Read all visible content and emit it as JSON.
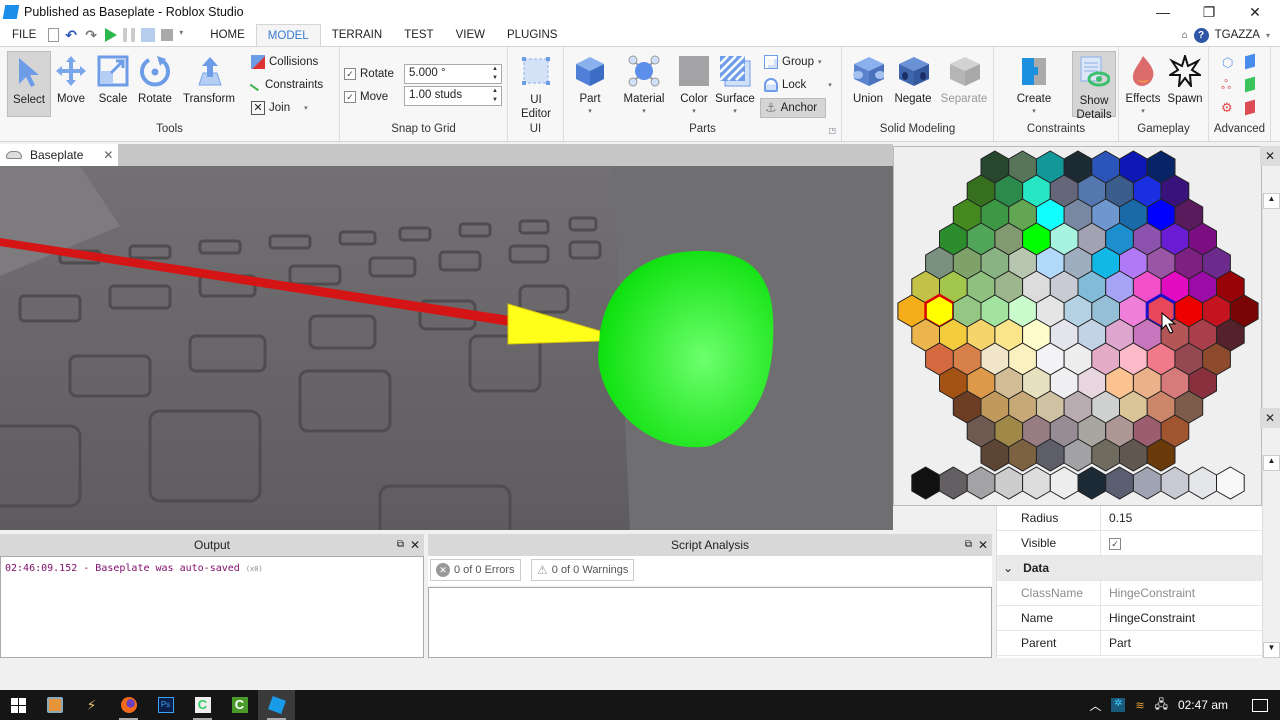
{
  "window": {
    "title": "Published as Baseplate - Roblox Studio",
    "controls": {
      "minimize": "—",
      "restore": "❐",
      "close": "✕"
    }
  },
  "menubar": {
    "file": "FILE",
    "tabs": [
      "HOME",
      "MODEL",
      "TERRAIN",
      "TEST",
      "VIEW",
      "PLUGINS"
    ],
    "active_tab": "MODEL",
    "user": "TGAZZA",
    "help": "?"
  },
  "ribbon": {
    "tools": {
      "label": "Tools",
      "select": "Select",
      "move": "Move",
      "scale": "Scale",
      "rotate": "Rotate",
      "transform": "Transform",
      "collisions": "Collisions",
      "constraints": "Constraints",
      "join": "Join"
    },
    "snap": {
      "label": "Snap to Grid",
      "rotate_label": "Rotate",
      "rotate_checked": true,
      "rotate_value": "5.000 °",
      "move_label": "Move",
      "move_checked": true,
      "move_value": "1.00 studs"
    },
    "ui": {
      "label": "UI",
      "editor": "UI Editor"
    },
    "parts": {
      "label": "Parts",
      "part": "Part",
      "material": "Material",
      "color": "Color",
      "surface": "Surface",
      "group": "Group",
      "lock": "Lock",
      "anchor": "Anchor"
    },
    "solid": {
      "label": "Solid Modeling",
      "union": "Union",
      "negate": "Negate",
      "separate": "Separate"
    },
    "constraints": {
      "label": "Constraints",
      "create": "Create",
      "show_details": "Show Details"
    },
    "gameplay": {
      "label": "Gameplay",
      "effects": "Effects",
      "spawn": "Spawn"
    },
    "advanced": {
      "label": "Advanced"
    }
  },
  "doc_tab": {
    "label": "Baseplate",
    "close": "✕"
  },
  "palette": {
    "rows": [
      [
        "#27472e",
        "#587459",
        "#13989a",
        "#1c2a33",
        "#2b55b8",
        "#0d17b4",
        "#072566"
      ],
      [
        "#36701f",
        "#2c8a4c",
        "#27e6c4",
        "#66667a",
        "#5477b0",
        "#3a5d8c",
        "#1a2fe0",
        "#3a127b"
      ],
      [
        "#458a1e",
        "#3c9844",
        "#62a653",
        "#13ffff",
        "#7888a2",
        "#6f97cf",
        "#1b6aa8",
        "#0000ff",
        "#5a1b5d"
      ],
      [
        "#2b8d2b",
        "#52a659",
        "#829a70",
        "#00ff00",
        "#a7f3e0",
        "#a3a2b3",
        "#1d8ece",
        "#8c52ad",
        "#6a1bd4",
        "#7c0e83"
      ],
      [
        "#7b917f",
        "#7fa26a",
        "#89b383",
        "#b7c6b0",
        "#b2d9fa",
        "#9eaebe",
        "#11b8e6",
        "#b07af6",
        "#9a56a5",
        "#7e1f82",
        "#6c2a8c"
      ],
      [
        "#c2c246",
        "#a2c64c",
        "#90c07f",
        "#9eb68d",
        "#dcdcdc",
        "#c9cbd4",
        "#80bcd8",
        "#a7a3f7",
        "#f24fcb",
        "#e20bc2",
        "#9c0aa7",
        "#970306"
      ],
      [
        "#f5ae1a",
        "#ffff00",
        "#95c784",
        "#a3e3a0",
        "#c9fbcc",
        "#e5e5e5",
        "#b4d2e4",
        "#94bfd6",
        "#f07fdb",
        "#e8475a",
        "#ed0000",
        "#c5141f",
        "#790505"
      ],
      [
        "#ecb54b",
        "#f2cc3d",
        "#f4d46b",
        "#fbe58a",
        "#fefcca",
        "#e4e4ec",
        "#c3d3e6",
        "#dea5cf",
        "#c776bd",
        "#b45557",
        "#a93f4b",
        "#55212b"
      ],
      [
        "#d5693f",
        "#d88049",
        "#f0e5c8",
        "#faf0c0",
        "#f3f3f5",
        "#ededed",
        "#e3abc6",
        "#fcbac9",
        "#f17a8a",
        "#934852",
        "#8e4a2d"
      ],
      [
        "#a55314",
        "#dd9949",
        "#d2bd96",
        "#e8e1c0",
        "#efeff1",
        "#e7d6de",
        "#fcc290",
        "#ebb18b",
        "#d77b7a",
        "#89303e"
      ],
      [
        "#6d3e24",
        "#c1995d",
        "#c7a977",
        "#cfc2a2",
        "#b9acb1",
        "#cfd0d0",
        "#d9c597",
        "#cc876a",
        "#7d5c4c"
      ],
      [
        "#6e5a51",
        "#a08849",
        "#977c83",
        "#978b94",
        "#a8a6a1",
        "#ae9895",
        "#9b5d6f",
        "#a0552e"
      ],
      [
        "#5c4534",
        "#7c6240",
        "#5e5e69",
        "#a2a2a4",
        "#706b5f",
        "#625650",
        "#6b3a0b"
      ]
    ],
    "grays": [
      "#111111",
      "#635f62",
      "#a3a2a5",
      "#cdcdcd",
      "#dddddd",
      "#ededed",
      "#1b2a35",
      "#595e70",
      "#a0a4b2",
      "#c8c9d2",
      "#e5e6ea",
      "#f8f8f8"
    ],
    "selected": "#e8475a",
    "highlighted": "#ffff00"
  },
  "properties": {
    "rows": [
      {
        "key": "Radius",
        "value": "0.15"
      },
      {
        "key": "Visible",
        "value": "☑",
        "checked": true
      }
    ],
    "category": "Data",
    "data_rows": [
      {
        "key": "ClassName",
        "value": "HingeConstraint",
        "readonly": true
      },
      {
        "key": "Name",
        "value": "HingeConstraint"
      },
      {
        "key": "Parent",
        "value": "Part"
      }
    ]
  },
  "output": {
    "title": "Output",
    "lines": [
      {
        "text": "02:46:09.152 - Baseplate was auto-saved",
        "suffix": "(x0)"
      }
    ]
  },
  "script_analysis": {
    "title": "Script Analysis",
    "errors": "0 of 0 Errors",
    "warnings": "0 of 0 Warnings"
  },
  "taskbar": {
    "time": "02:47 am",
    "apps": [
      "windows-start",
      "media-player",
      "ftl",
      "firefox",
      "photoshop",
      "camtasia-recorder",
      "camtasia-studio",
      "roblox-studio"
    ]
  }
}
